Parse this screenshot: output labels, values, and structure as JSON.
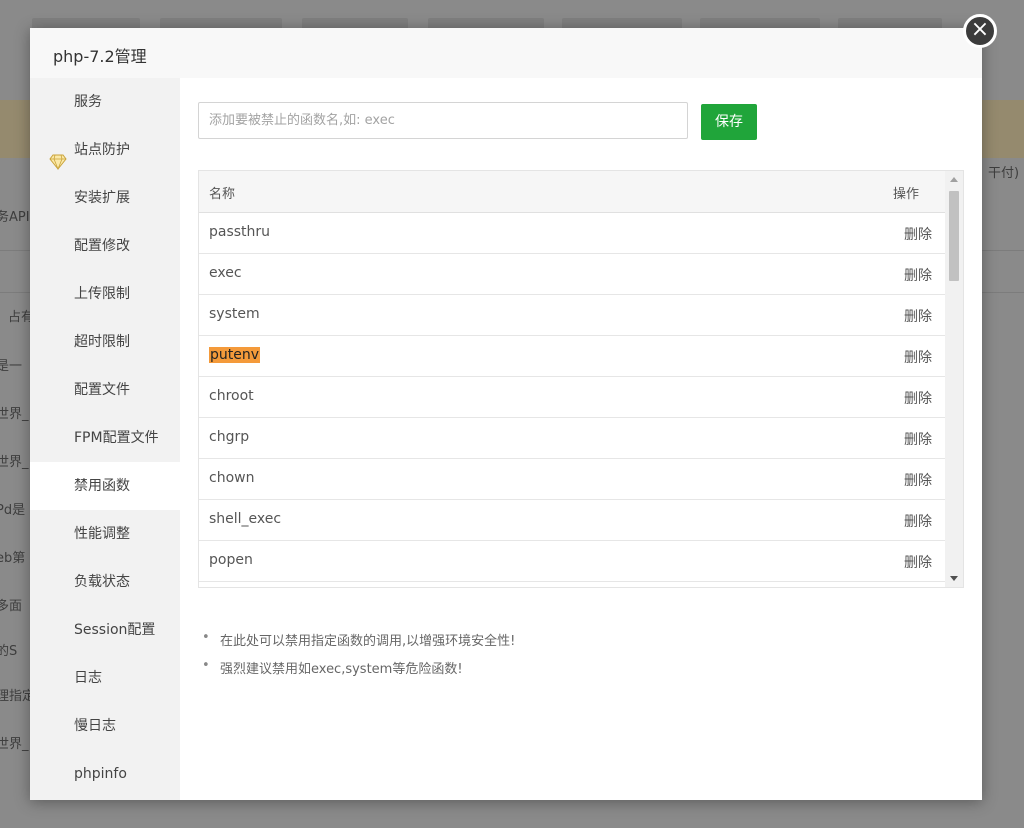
{
  "dialog": {
    "title": "php-7.2管理",
    "close_glyph": "×"
  },
  "sidebar": {
    "items": [
      {
        "label": "服务"
      },
      {
        "label": "站点防护",
        "icon": "gem-icon"
      },
      {
        "label": "安装扩展"
      },
      {
        "label": "配置修改"
      },
      {
        "label": "上传限制"
      },
      {
        "label": "超时限制"
      },
      {
        "label": "配置文件"
      },
      {
        "label": "FPM配置文件"
      },
      {
        "label": "禁用函数",
        "active": true
      },
      {
        "label": "性能调整"
      },
      {
        "label": "负载状态"
      },
      {
        "label": "Session配置"
      },
      {
        "label": "日志"
      },
      {
        "label": "慢日志"
      },
      {
        "label": "phpinfo"
      }
    ]
  },
  "main": {
    "input_placeholder": "添加要被禁止的函数名,如: exec",
    "input_value": "",
    "save_label": "保存",
    "table": {
      "headers": {
        "name": "名称",
        "action": "操作"
      },
      "rows": [
        {
          "name": "passthru",
          "action": "删除"
        },
        {
          "name": "exec",
          "action": "删除"
        },
        {
          "name": "system",
          "action": "删除"
        },
        {
          "name": "putenv",
          "action": "删除",
          "highlighted": true
        },
        {
          "name": "chroot",
          "action": "删除"
        },
        {
          "name": "chgrp",
          "action": "删除"
        },
        {
          "name": "chown",
          "action": "删除"
        },
        {
          "name": "shell_exec",
          "action": "删除"
        },
        {
          "name": "popen",
          "action": "删除"
        }
      ]
    },
    "tips": [
      "在此处可以禁用指定函数的调用,以增强环境安全性!",
      "强烈建议禁用如exec,system等危险函数!"
    ]
  },
  "background": {
    "left_fragments": [
      "务API",
      "占有",
      "是一",
      "世界_",
      "世界_",
      "Pd是",
      "eb第",
      "多面",
      "的S",
      "理指定",
      "世界_"
    ],
    "right_fragment": "干付)"
  },
  "colors": {
    "accent_green": "#20a53a",
    "highlight_orange": "#f49a3a",
    "overlay": "#8a8a8a"
  }
}
